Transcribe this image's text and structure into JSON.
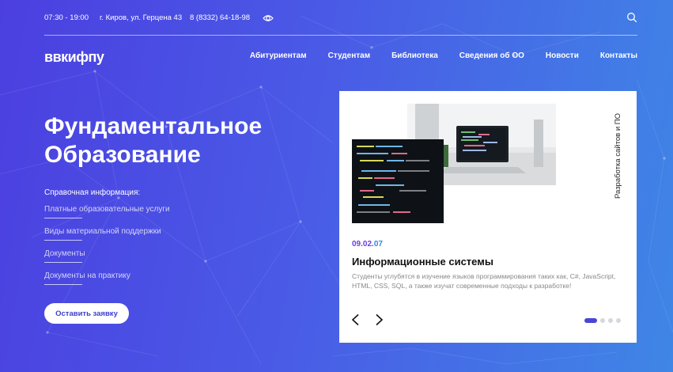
{
  "topbar": {
    "hours": "07:30 - 19:00",
    "address": "г. Киров, ул. Герцена 43",
    "phone": "8 (8332) 64-18-98"
  },
  "header": {
    "logo": "ввкифпу",
    "nav": [
      "Абитуриентам",
      "Студентам",
      "Библиотека",
      "Сведения об ОО",
      "Новости",
      "Контакты"
    ]
  },
  "hero": {
    "title_line1": "Фундаментальное",
    "title_line2": "Образование",
    "info_heading": "Справочная информация:",
    "links": [
      "Платные образовательные услуги",
      "Виды материальной поддержки",
      "Документы",
      "Документы на практику"
    ],
    "cta_label": "Оставить заявку"
  },
  "card": {
    "vertical_label": "Разработка сайтов и ПО",
    "date_part1": "09.02.",
    "date_part2": "07",
    "title": "Информационные системы",
    "description": "Студенты углубятся в изучение языков программирования таких как, C#, JavaScript, HTML, CSS, SQL, а также изучат современные подходы к разработке!",
    "slides_total": 4,
    "active_slide": 1
  },
  "colors": {
    "bg_start": "#4b3fe0",
    "bg_end": "#3f86e6",
    "date_accent1": "#6a3fe0",
    "date_accent2": "#2e86e6",
    "dot_active": "#4a45d8"
  },
  "icons": {
    "visibility": "eye-icon",
    "search": "search-icon",
    "prev": "chevron-left-icon",
    "next": "chevron-right-icon"
  }
}
